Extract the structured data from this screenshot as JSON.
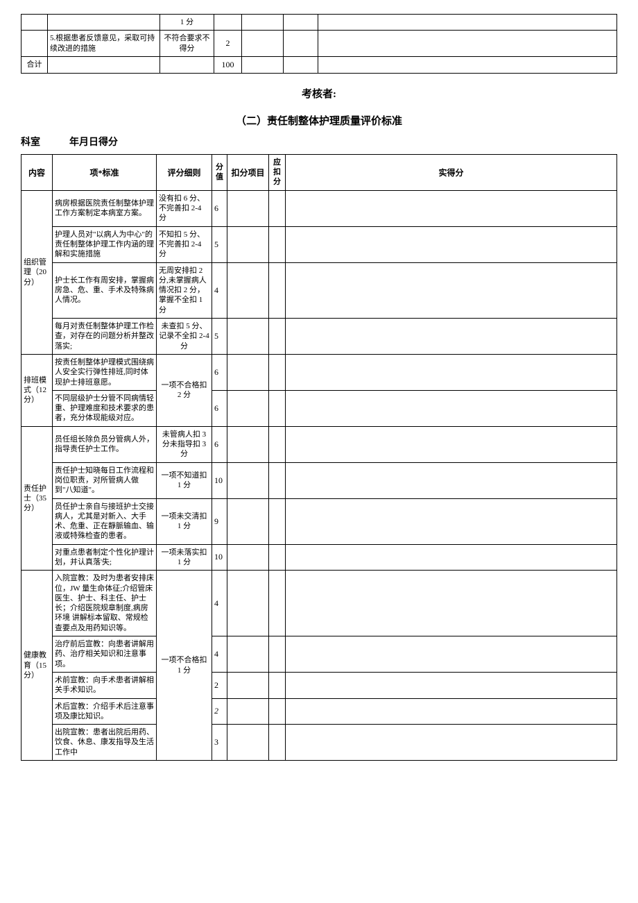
{
  "top_table": {
    "r1c3": "1 分",
    "r2c2": "5.根据患者反馈意见，采取可持续改进的措施",
    "r2c3": "不符合要求不得分",
    "r2c4": "2",
    "sum_label": "合计",
    "sum_val": "100"
  },
  "assessor": "考核者:",
  "section2_title": "（二）责任制整体护理质量评价标准",
  "form_header": "科室　　　年月日得分",
  "hdr": {
    "c1": "内容",
    "c2": "项*标准",
    "c3": "评分细则",
    "c4": "分值",
    "c5": "扣分项目",
    "c6": "应扣分",
    "c7": "实得分"
  },
  "g1": {
    "name": "组织管理（20分）",
    "r1s": "病房根据医院责任制整体护理工作方案制定本病室方案。",
    "r1c": "没有扣 6 分、不完善扣 2-4 分",
    "r1v": "6",
    "r2s": "护理人员对\"以病人为中心\"的责任制整体护理工作内涵的理解和实施措施",
    "r2c": "不知扣 5 分、不完善扣 2-4 分",
    "r2v": "5",
    "r3s": "护士长工作有周安排，掌握病房急、危、重、手术及特殊病人情况。",
    "r3c": "无周安排扣 2 分,未掌握病人情况扣 2 分，掌握不全扣 1 分",
    "r3v": "4",
    "r4s": "每月对责任制整体护理工作检查，对存在的问题分析并整改落实;",
    "r4c": "未查扣 5 分、记录不全扣 2-4 分",
    "r4v": "5"
  },
  "g2": {
    "name": "排班模式（12分）",
    "r1s": "按责任制整体护理模式围绕病人安全实行弹性排班,同时体现护士排班意愿。",
    "r1v": "6",
    "r2s": "不同层级护士分管不同病情轻重、护理难度和技术要求的患者，充分体现能级对应。",
    "r2v": "6",
    "crit": "一项不合格扣 2 分"
  },
  "g3": {
    "name": "责任护士（35分）",
    "r1s": "员任组长除负员分管病人外，指导责任护士工作。",
    "r1c": "未管病人扣 3 分未指导扣 3 分",
    "r1v": "6",
    "r2s": "责任护士知晓每日工作流程和岗位职责，对所管病人做到\"八知道\"。",
    "r2c": "一项不知道扣 1 分",
    "r2v": "10",
    "r3s": "员任护士亲自与接班护士交接病人，尤其是对新入、大手术、危重、正在靜脈输血、输液或特殊检查的患者。",
    "r3c": "一项未交清扣 1 分",
    "r3v": "9",
    "r4s": "对重点患者制定个性化护理计划，并认真落'失;",
    "r4c": "一项未落实扣 1 分",
    "r4v": "10"
  },
  "g4": {
    "name": "健康教育（15分）",
    "r1s": "入院宣教：及时为患者安排床位，JW 量生命体征;介绍管床医生、护士、科主任、护士长；介绍医院规章制度,病房环境  讲解标本留取、常规检查要点及用药知识等。",
    "r1v": "4",
    "r2s": "治疗前后宣教：向患者讲解用药、治疗相关知识和注意事项。",
    "r2v": "4",
    "r3s": "术前宣教：向手术患者讲解相关手术知识。",
    "r3v": "2",
    "r4s": "术后宣教：介绍手术后注意事项及康比知识。",
    "r4v": "2",
    "r5s": "出院宣教：患者出院后用药、饮食、休息、康发指导及生活工作中",
    "r5v": "3",
    "crit": "一项不合格扣 1 分"
  }
}
